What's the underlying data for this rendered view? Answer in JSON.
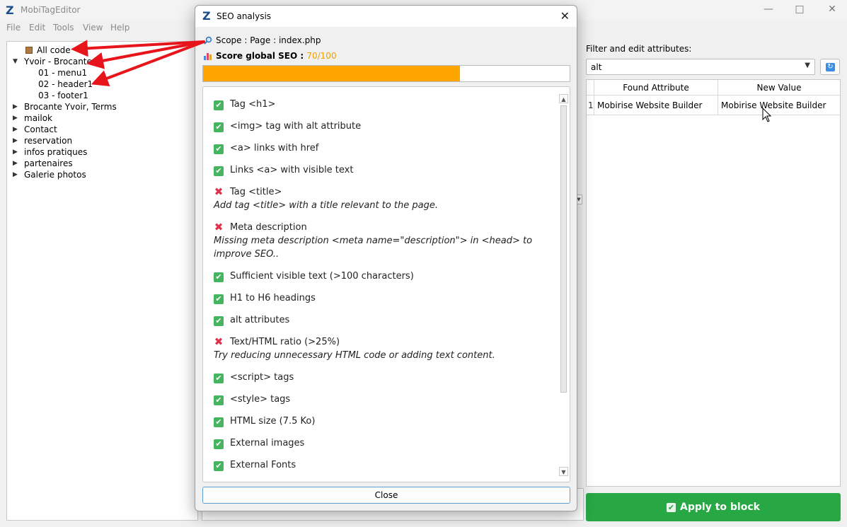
{
  "app": {
    "title": "MobiTagEditor",
    "logo": "Z"
  },
  "menu": [
    "File",
    "Edit",
    "Tools",
    "View",
    "Help"
  ],
  "tree": {
    "items": [
      {
        "label": "All code",
        "level": 1,
        "arrow": ""
      },
      {
        "label": "Yvoir - Brocante",
        "level": 0,
        "arrow": "down"
      },
      {
        "label": "01 - menu1",
        "level": 2,
        "arrow": ""
      },
      {
        "label": "02 - header1",
        "level": 2,
        "arrow": ""
      },
      {
        "label": "03 - footer1",
        "level": 2,
        "arrow": ""
      },
      {
        "label": "Brocante Yvoir, Terms",
        "level": 0,
        "arrow": "right"
      },
      {
        "label": "mailok",
        "level": 0,
        "arrow": "right"
      },
      {
        "label": "Contact",
        "level": 0,
        "arrow": "right"
      },
      {
        "label": "reservation",
        "level": 0,
        "arrow": "right"
      },
      {
        "label": "infos pratiques",
        "level": 0,
        "arrow": "right"
      },
      {
        "label": "partenaires",
        "level": 0,
        "arrow": "right"
      },
      {
        "label": "Galerie photos",
        "level": 0,
        "arrow": "right"
      }
    ]
  },
  "right": {
    "filter_label": "Filter and edit attributes:",
    "filter_value": "alt",
    "table": {
      "headers": [
        "Found Attribute",
        "New Value"
      ],
      "rows": [
        {
          "index": "1",
          "found": "Mobirise Website Builder",
          "new": "Mobirise Website Builder"
        }
      ]
    },
    "apply_label": "Apply to block",
    "accent": "#28a745"
  },
  "dialog": {
    "title": "SEO analysis",
    "scope_label": "Scope : Page : index.php",
    "score_label": "Score global SEO : ",
    "score_value": "70/100",
    "score_fraction": 0.7,
    "progress_color": "#ffa500",
    "results": [
      {
        "status": "ok",
        "title": "Tag <h1>",
        "hint": ""
      },
      {
        "status": "ok",
        "title": "<img> tag with alt attribute",
        "hint": ""
      },
      {
        "status": "ok",
        "title": "<a> links with href",
        "hint": ""
      },
      {
        "status": "ok",
        "title": "Links <a> with visible text",
        "hint": ""
      },
      {
        "status": "ko",
        "title": "Tag <title>",
        "hint": "Add tag <title> with a title relevant to the page."
      },
      {
        "status": "ko",
        "title": "Meta description",
        "hint": "Missing meta description <meta name=\"description\"> in <head> to improve SEO.."
      },
      {
        "status": "ok",
        "title": "Sufficient visible text (>100 characters)",
        "hint": ""
      },
      {
        "status": "ok",
        "title": "H1 to H6 headings",
        "hint": ""
      },
      {
        "status": "ok",
        "title": "alt attributes",
        "hint": ""
      },
      {
        "status": "ko",
        "title": "Text/HTML ratio (>25%)",
        "hint": "Try reducing unnecessary HTML code or adding text content."
      },
      {
        "status": "ok",
        "title": "<script> tags",
        "hint": ""
      },
      {
        "status": "ok",
        "title": "<style> tags",
        "hint": ""
      },
      {
        "status": "ok",
        "title": "HTML size (7.5 Ko)",
        "hint": ""
      },
      {
        "status": "ok",
        "title": "External images",
        "hint": ""
      },
      {
        "status": "ok",
        "title": "External Fonts",
        "hint": ""
      }
    ],
    "close_label": "Close"
  }
}
